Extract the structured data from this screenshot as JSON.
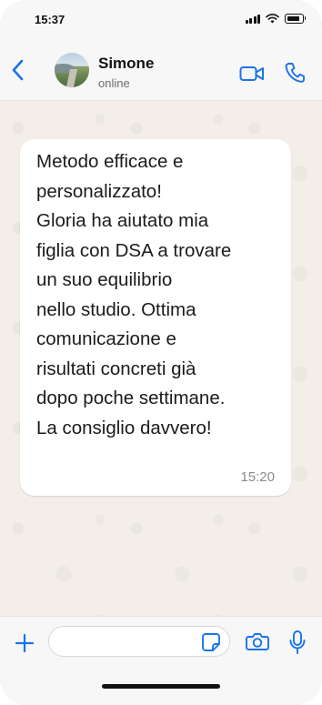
{
  "status_bar": {
    "time": "15:37"
  },
  "header": {
    "contact_name": "Simone",
    "contact_status": "online",
    "icons": {
      "back": "chevron-left-icon",
      "video": "video-camera-icon",
      "call": "phone-icon"
    }
  },
  "messages": [
    {
      "text": "Metodo efficace e\npersonalizzato!\nGloria ha aiutato mia\nfiglia con DSA a trovare\nun suo equilibrio\nnello studio. Ottima\ncomunicazione e\nrisultati concreti già\ndopo poche settimane.\nLa consiglio davvero!",
      "time": "15:20"
    }
  ],
  "input_bar": {
    "message_value": "",
    "icons": {
      "plus": "plus-icon",
      "sticker": "sticker-icon",
      "camera": "camera-icon",
      "mic": "microphone-icon"
    }
  },
  "colors": {
    "accent": "#1a73e8",
    "chat_background": "#f3efe8",
    "bubble": "#ffffff",
    "timestamp": "#8a8a8a"
  }
}
